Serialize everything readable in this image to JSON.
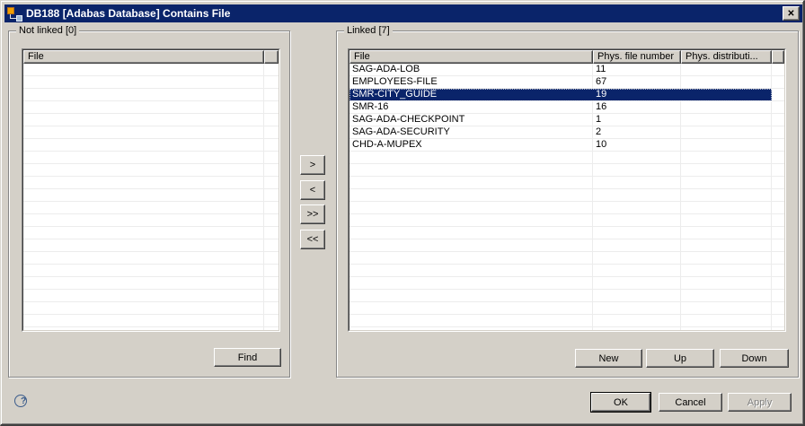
{
  "window": {
    "title": "DB188 [Adabas Database] Contains File",
    "close_glyph": "✕"
  },
  "colors": {
    "titlebar": "#0a246a",
    "selection": "#0a246a",
    "dialog_bg": "#d4d0c8"
  },
  "not_linked": {
    "label": "Not linked [0]",
    "columns": [
      "File"
    ],
    "rows": [],
    "find_label": "Find"
  },
  "linked": {
    "label": "Linked [7]",
    "columns": [
      "File",
      "Phys. file number",
      "Phys. distributi..."
    ],
    "selected_index": 2,
    "rows": [
      {
        "file": "SAG-ADA-LOB",
        "phys_file_number": "11",
        "phys_distribution": ""
      },
      {
        "file": "EMPLOYEES-FILE",
        "phys_file_number": "67",
        "phys_distribution": ""
      },
      {
        "file": "SMR-CITY_GUIDE",
        "phys_file_number": "19",
        "phys_distribution": ""
      },
      {
        "file": "SMR-16",
        "phys_file_number": "16",
        "phys_distribution": ""
      },
      {
        "file": "SAG-ADA-CHECKPOINT",
        "phys_file_number": "1",
        "phys_distribution": ""
      },
      {
        "file": "SAG-ADA-SECURITY",
        "phys_file_number": "2",
        "phys_distribution": ""
      },
      {
        "file": "CHD-A-MUPEX",
        "phys_file_number": "10",
        "phys_distribution": ""
      }
    ],
    "buttons": {
      "new": "New",
      "up": "Up",
      "down": "Down"
    }
  },
  "transfer": {
    "move_right": ">",
    "move_left": "<",
    "move_all_right": ">>",
    "move_all_left": "<<"
  },
  "footer": {
    "ok": "OK",
    "cancel": "Cancel",
    "apply": "Apply",
    "help_glyph": "?"
  }
}
